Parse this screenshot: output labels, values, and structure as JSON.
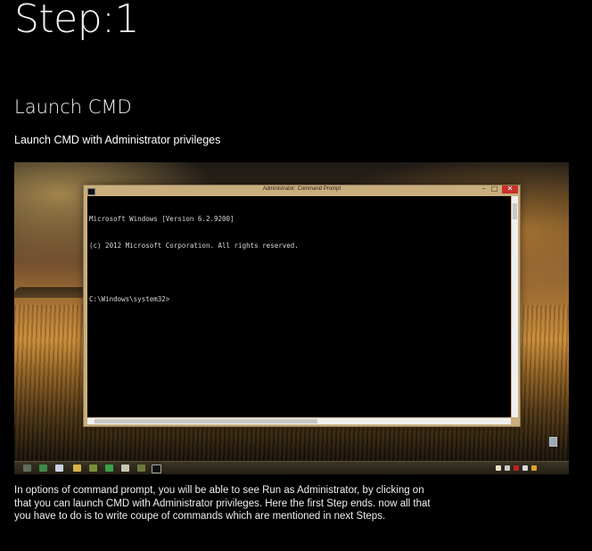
{
  "page": {
    "step_title": "Step:1",
    "section_heading": "Launch CMD",
    "subtitle": "Launch CMD with Administrator privileges",
    "description": "In options of command prompt, you will be able to see Run as Administrator, by clicking on that you can launch CMD with Administrator privileges. Here the first Step ends. now all that you have to do is to write coupe of commands which are mentioned in next Steps."
  },
  "screenshot": {
    "window_title": "Administrator: Command Prompt",
    "console_lines": [
      "Microsoft Windows [Version 6.2.9200]",
      "(c) 2012 Microsoft Corporation. All rights reserved.",
      "",
      "C:\\Windows\\system32>"
    ],
    "window_buttons": {
      "minimize": "–",
      "maximize": "□",
      "close": "✕"
    },
    "taskbar_icons": [
      "explorer-icon",
      "ie-icon",
      "media-icon",
      "folder-icon",
      "app-icon",
      "app-icon",
      "app-icon",
      "app-icon",
      "cmd-icon"
    ],
    "colors": {
      "close": "#c7302b",
      "console_bg": "#000000",
      "console_text": "#d8d8d8",
      "frame": "#c9ae7e"
    }
  }
}
